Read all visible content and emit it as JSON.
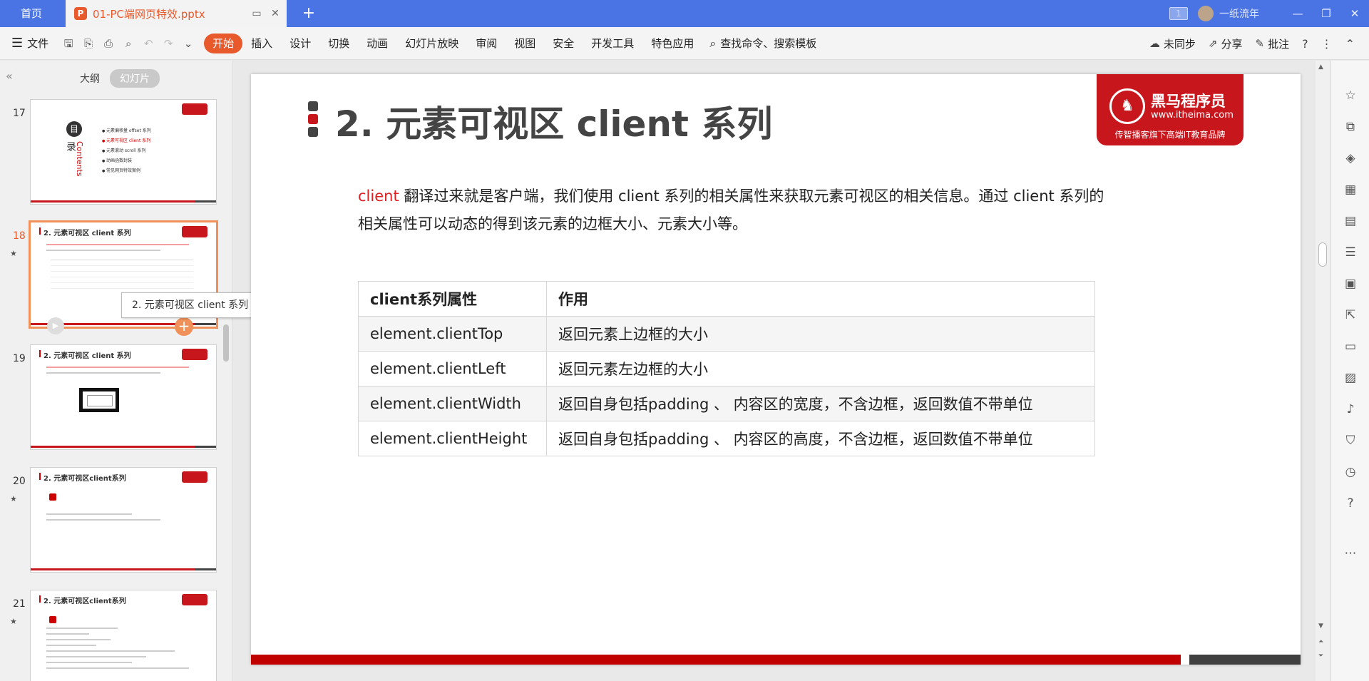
{
  "titlebar": {
    "home_tab": "首页",
    "doc_tab": "01-PC端网页特效.pptx",
    "doc_icon": "P",
    "add_tab": "+",
    "window_count": "1",
    "user_name": "一纸流年"
  },
  "ribbon": {
    "file_label": "文件",
    "tabs": [
      "开始",
      "插入",
      "设计",
      "切换",
      "动画",
      "幻灯片放映",
      "审阅",
      "视图",
      "安全",
      "开发工具",
      "特色应用"
    ],
    "search_label": "查找命令、搜索模板",
    "sync_label": "未同步",
    "share_label": "分享",
    "comment_label": "批注"
  },
  "panel": {
    "outline_label": "大纲",
    "slides_label": "幻灯片",
    "thumbnails": [
      {
        "num": "17",
        "title": "",
        "lu": "录",
        "contents": "Contents",
        "toc": [
          "元素偏移量 offset 系列",
          "元素可视区 client 系列",
          "元素滚动 scroll 系列",
          "动画函数封装",
          "常见网页特效案例"
        ]
      },
      {
        "num": "18",
        "title": "2. 元素可视区 client 系列"
      },
      {
        "num": "19",
        "title": "2. 元素可视区 client 系列"
      },
      {
        "num": "20",
        "title": "2. 元素可视区client系列"
      },
      {
        "num": "21",
        "title": "2. 元素可视区client系列"
      }
    ],
    "tooltip": "2. 元素可视区 client 系列"
  },
  "slide": {
    "title": "2. 元素可视区 client 系列",
    "logo": {
      "name": "黑马程序员",
      "url": "www.itheima.com",
      "slogan": "传智播客旗下高端IT教育品牌"
    },
    "para_keyword": "client",
    "para_rest": " 翻译过来就是客户端，我们使用 client 系列的相关属性来获取元素可视区的相关信息。通过 client 系列的相关属性可以动态的得到该元素的边框大小、元素大小等。",
    "table": {
      "headers": [
        "client系列属性",
        "作用"
      ],
      "rows": [
        [
          "element.clientTop",
          "返回元素上边框的大小"
        ],
        [
          "element.clientLeft",
          "返回元素左边框的大小"
        ],
        [
          "element.clientWidth",
          "返回自身包括padding 、 内容区的宽度，不含边框，返回数值不带单位"
        ],
        [
          "element.clientHeight",
          "返回自身包括padding 、 内容区的高度，不含边框，返回数值不带单位"
        ]
      ]
    }
  },
  "colors": {
    "accent": "#e8592c",
    "brand_red": "#c8161d",
    "titlebar": "#4a74e4"
  }
}
